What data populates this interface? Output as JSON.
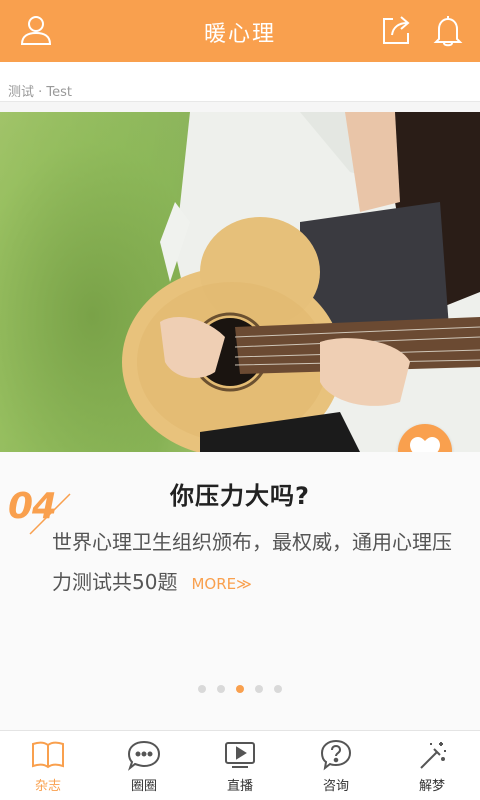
{
  "header": {
    "title": "暖心理",
    "profile_icon": "user-icon",
    "share_icon": "share-icon",
    "notify_icon": "bell-icon"
  },
  "breadcrumb": "测试 · Test",
  "article": {
    "issue": "04",
    "title": "你压力大吗?",
    "summary": "世界心理卫生组织颁布，最权威，通用心理压力测试共50题",
    "more": "MORE≫",
    "favorite_icon": "heart-icon"
  },
  "carousel": {
    "count": 5,
    "active_index": 2
  },
  "tabs": [
    {
      "label": "杂志",
      "icon": "book-icon"
    },
    {
      "label": "圈圈",
      "icon": "chat-bubble-icon"
    },
    {
      "label": "直播",
      "icon": "play-icon"
    },
    {
      "label": "咨询",
      "icon": "question-icon"
    },
    {
      "label": "解梦",
      "icon": "magic-wand-icon"
    }
  ],
  "colors": {
    "accent": "#f9a04e",
    "tab_inactive": "#333333"
  }
}
